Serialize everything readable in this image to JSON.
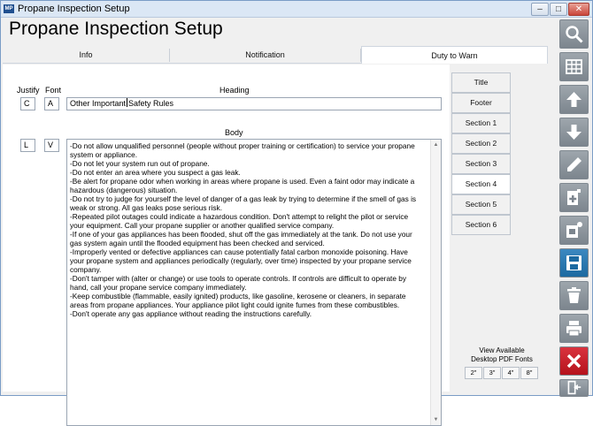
{
  "window": {
    "title": "Propane Inspection Setup",
    "app_icon_text": "MP",
    "controls": [
      "–",
      "□",
      "✕"
    ]
  },
  "page_title": "Propane Inspection Setup",
  "tabs": [
    {
      "label": "Info"
    },
    {
      "label": "Notification"
    },
    {
      "label": "Duty to Warn",
      "active": true
    }
  ],
  "heading_row": {
    "justify_label": "Justify",
    "font_label": "Font",
    "heading_label": "Heading",
    "justify_value": "C",
    "font_value": "A",
    "heading_value_before_cursor": "Other Important",
    "heading_value_after_cursor": "Safety Rules"
  },
  "body_row": {
    "body_label": "Body",
    "justify_value": "L",
    "font_value": "V",
    "text": "-Do not allow unqualified personnel (people without proper training or certification) to service your propane\nsystem or appliance.\n-Do not let your system run out of propane.\n-Do not enter an area where you suspect a gas leak.\n-Be alert for propane odor when working in areas where propane is used. Even a faint odor may indicate a\nhazardous (dangerous) situation.\n-Do not try to judge for yourself the level of danger of a gas leak by trying to determine if the smell of gas is\nweak or strong. All gas leaks pose serious risk.\n-Repeated pilot outages could indicate a hazardous condition. Don't attempt to relight the pilot or service\nyour equipment. Call your propane supplier or another qualified service company.\n-If one of your gas appliances has been flooded, shut off the gas immediately at the tank. Do not use your\ngas system again until the flooded equipment has been checked and serviced.\n-Improperly vented or defective appliances can cause potentially fatal carbon monoxide poisoning. Have\nyour propane system and appliances periodically (regularly, over time) inspected by your propane service\ncompany.\n-Don't tamper with (alter or change) or use tools to operate controls. If controls are difficult to operate by\nhand, call your propane service company immediately.\n-Keep combustible (flammable, easily ignited) products, like gasoline, kerosene or cleaners, in separate\nareas from propane appliances. Your appliance pilot light could ignite fumes from these combustibles.\n-Don't operate any gas appliance without reading the instructions carefully."
  },
  "sections": [
    {
      "label": "Title"
    },
    {
      "label": "Footer"
    },
    {
      "label": "Section 1"
    },
    {
      "label": "Section 2"
    },
    {
      "label": "Section 3"
    },
    {
      "label": "Section 4",
      "active": true
    },
    {
      "label": "Section 5"
    },
    {
      "label": "Section 6"
    }
  ],
  "pdf_fonts": {
    "title": "View Available\nDesktop PDF Fonts",
    "sizes": [
      "2\"",
      "3\"",
      "4\"",
      "8\""
    ]
  },
  "toolbar": [
    {
      "name": "search-icon"
    },
    {
      "name": "grid-icon"
    },
    {
      "name": "arrow-up-icon"
    },
    {
      "name": "arrow-down-icon"
    },
    {
      "name": "pencil-icon"
    },
    {
      "name": "add-document-icon"
    },
    {
      "name": "copy-document-icon"
    },
    {
      "name": "save-icon",
      "color": "#1c6aa1"
    },
    {
      "name": "trash-icon"
    },
    {
      "name": "print-icon"
    },
    {
      "name": "close-icon",
      "color": "#b5121c"
    },
    {
      "name": "exit-icon"
    }
  ]
}
